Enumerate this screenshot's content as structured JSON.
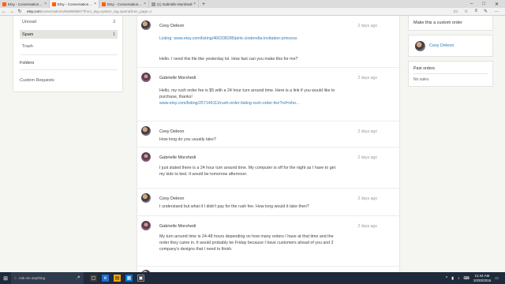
{
  "browser": {
    "tabs": [
      {
        "label": "Etsy - Conversations - Pick",
        "active": false,
        "favicon": "etsy"
      },
      {
        "label": "Etsy - Conversations - P",
        "active": true,
        "favicon": "etsy"
      },
      {
        "label": "Etsy - Conversations - Gabr",
        "active": false,
        "favicon": "etsy"
      },
      {
        "label": "(1) Gabrielle Morshedi",
        "active": false,
        "favicon": "generic"
      }
    ],
    "url_host": "etsy.com",
    "url_path": "/conversations/569589807?from_tag=system_tag.spam&from_page=1"
  },
  "left_panel": {
    "items": [
      {
        "label": "Unread",
        "count": "3"
      },
      {
        "label": "Spam",
        "count": "1"
      },
      {
        "label": "Trash",
        "count": ""
      }
    ],
    "folders_label": "Folders",
    "custom_requests_label": "Custom Requests"
  },
  "messages": [
    {
      "name": "Cesy Deleon",
      "time": "2 days ago",
      "avatar": "cesy",
      "lines": [
        {
          "text": "Listing: www.etsy.com/listing/466338285/pink-cinderella-invitation-princess",
          "link": true
        },
        {
          "text": "",
          "link": false
        },
        {
          "text": "Hello. I need this file like yesterday lol. How fast can you make this for me?",
          "link": false
        }
      ]
    },
    {
      "name": "Gabrielle Morshedi",
      "time": "2 days ago",
      "avatar": "gabrielle",
      "lines": [
        {
          "text": "Hello, my rush order fee is $5 with a 24 hour turn around time. Here is a link if you would like to",
          "link": false
        },
        {
          "text": "purchase, thanks!",
          "link": false
        },
        {
          "text": "www.etsy.com/listing/257149111/rush-order-listing-rush-order-fee?ref=sho...",
          "link": true
        }
      ]
    },
    {
      "name": "Cesy Deleon",
      "time": "2 days ago",
      "avatar": "cesy",
      "lines": [
        {
          "text": "How long do you usually take?",
          "link": false
        }
      ]
    },
    {
      "name": "Gabrielle Morshedi",
      "time": "2 days ago",
      "avatar": "gabrielle",
      "lines": [
        {
          "text": "I just stated there is a 24 hour turn around time. My computer is off for the night as I have to get",
          "link": false
        },
        {
          "text": "my kids to bed. It would be tomorrow afternoon.",
          "link": false
        }
      ]
    },
    {
      "name": "Cesy Deleon",
      "time": "2 days ago",
      "avatar": "cesy",
      "lines": [
        {
          "text": "I understand but what if I didn't pay for the rush fee. How long would it take then?",
          "link": false
        }
      ]
    },
    {
      "name": "Gabrielle Morshedi",
      "time": "2 days ago",
      "avatar": "gabrielle",
      "lines": [
        {
          "text": "My turn around time is 24-48 hours depending on how many orders I have at that time and the",
          "link": false
        },
        {
          "text": "order they came in. It would probably be Friday because I have customers ahead of you and 2",
          "link": false
        },
        {
          "text": "company's designs that I need to finish.",
          "link": false
        }
      ]
    }
  ],
  "right_panel": {
    "custom_order_label": "Make this a custom order",
    "contact_name": "Cesy Deleon",
    "past_orders_label": "Past orders",
    "no_sales_label": "No sales"
  },
  "taskbar": {
    "search_placeholder": "Ask me anything",
    "time": "11:44 AM",
    "date": "10/20/2016"
  },
  "colors": {
    "link": "#2b7bb9",
    "etsy_orange": "#f56400",
    "taskbar": "#1f2a3a"
  }
}
